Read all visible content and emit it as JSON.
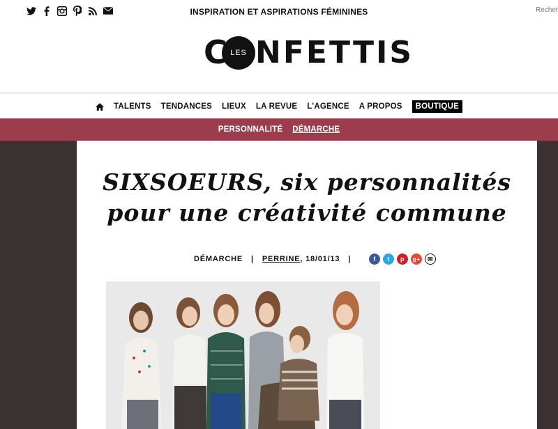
{
  "topbar": {
    "social_icons": [
      "twitter-icon",
      "facebook-icon",
      "instagram-icon",
      "pinterest-icon",
      "rss-icon",
      "mail-icon"
    ],
    "tagline": "INSPIRATION ET ASPIRATIONS FÉMININES",
    "search_placeholder": "Recherche"
  },
  "logo": {
    "c": "C",
    "les": "LES",
    "word": "NFETTIS"
  },
  "mainnav": {
    "items": [
      "TALENTS",
      "TENDANCES",
      "LIEUX",
      "LA REVUE",
      "L'AGENCE",
      "A PROPOS",
      "BOUTIQUE"
    ]
  },
  "subnav": {
    "items": [
      "PERSONNALITÉ",
      "DÉMARCHE"
    ],
    "active": "DÉMARCHE"
  },
  "article": {
    "title_line1": "SIXSOEURS, six personnalités",
    "title_line2": "pour une créativité commune",
    "category": "DÉMARCHE",
    "author": "PERRINE",
    "date": ", 18/01/13",
    "separator": "|"
  },
  "share": [
    {
      "icon": "facebook-icon",
      "glyph": "f",
      "color": "#3b5998"
    },
    {
      "icon": "twitter-icon",
      "glyph": "t",
      "color": "#2aa9e0"
    },
    {
      "icon": "pinterest-icon",
      "glyph": "p",
      "color": "#cb2027"
    },
    {
      "icon": "google-plus-icon",
      "glyph": "g+",
      "color": "#dd4b39"
    },
    {
      "icon": "email-icon",
      "glyph": "✉",
      "color": "#ffffff"
    }
  ],
  "colors": {
    "accent": "#9b3d4d",
    "background": "#3a3131"
  }
}
